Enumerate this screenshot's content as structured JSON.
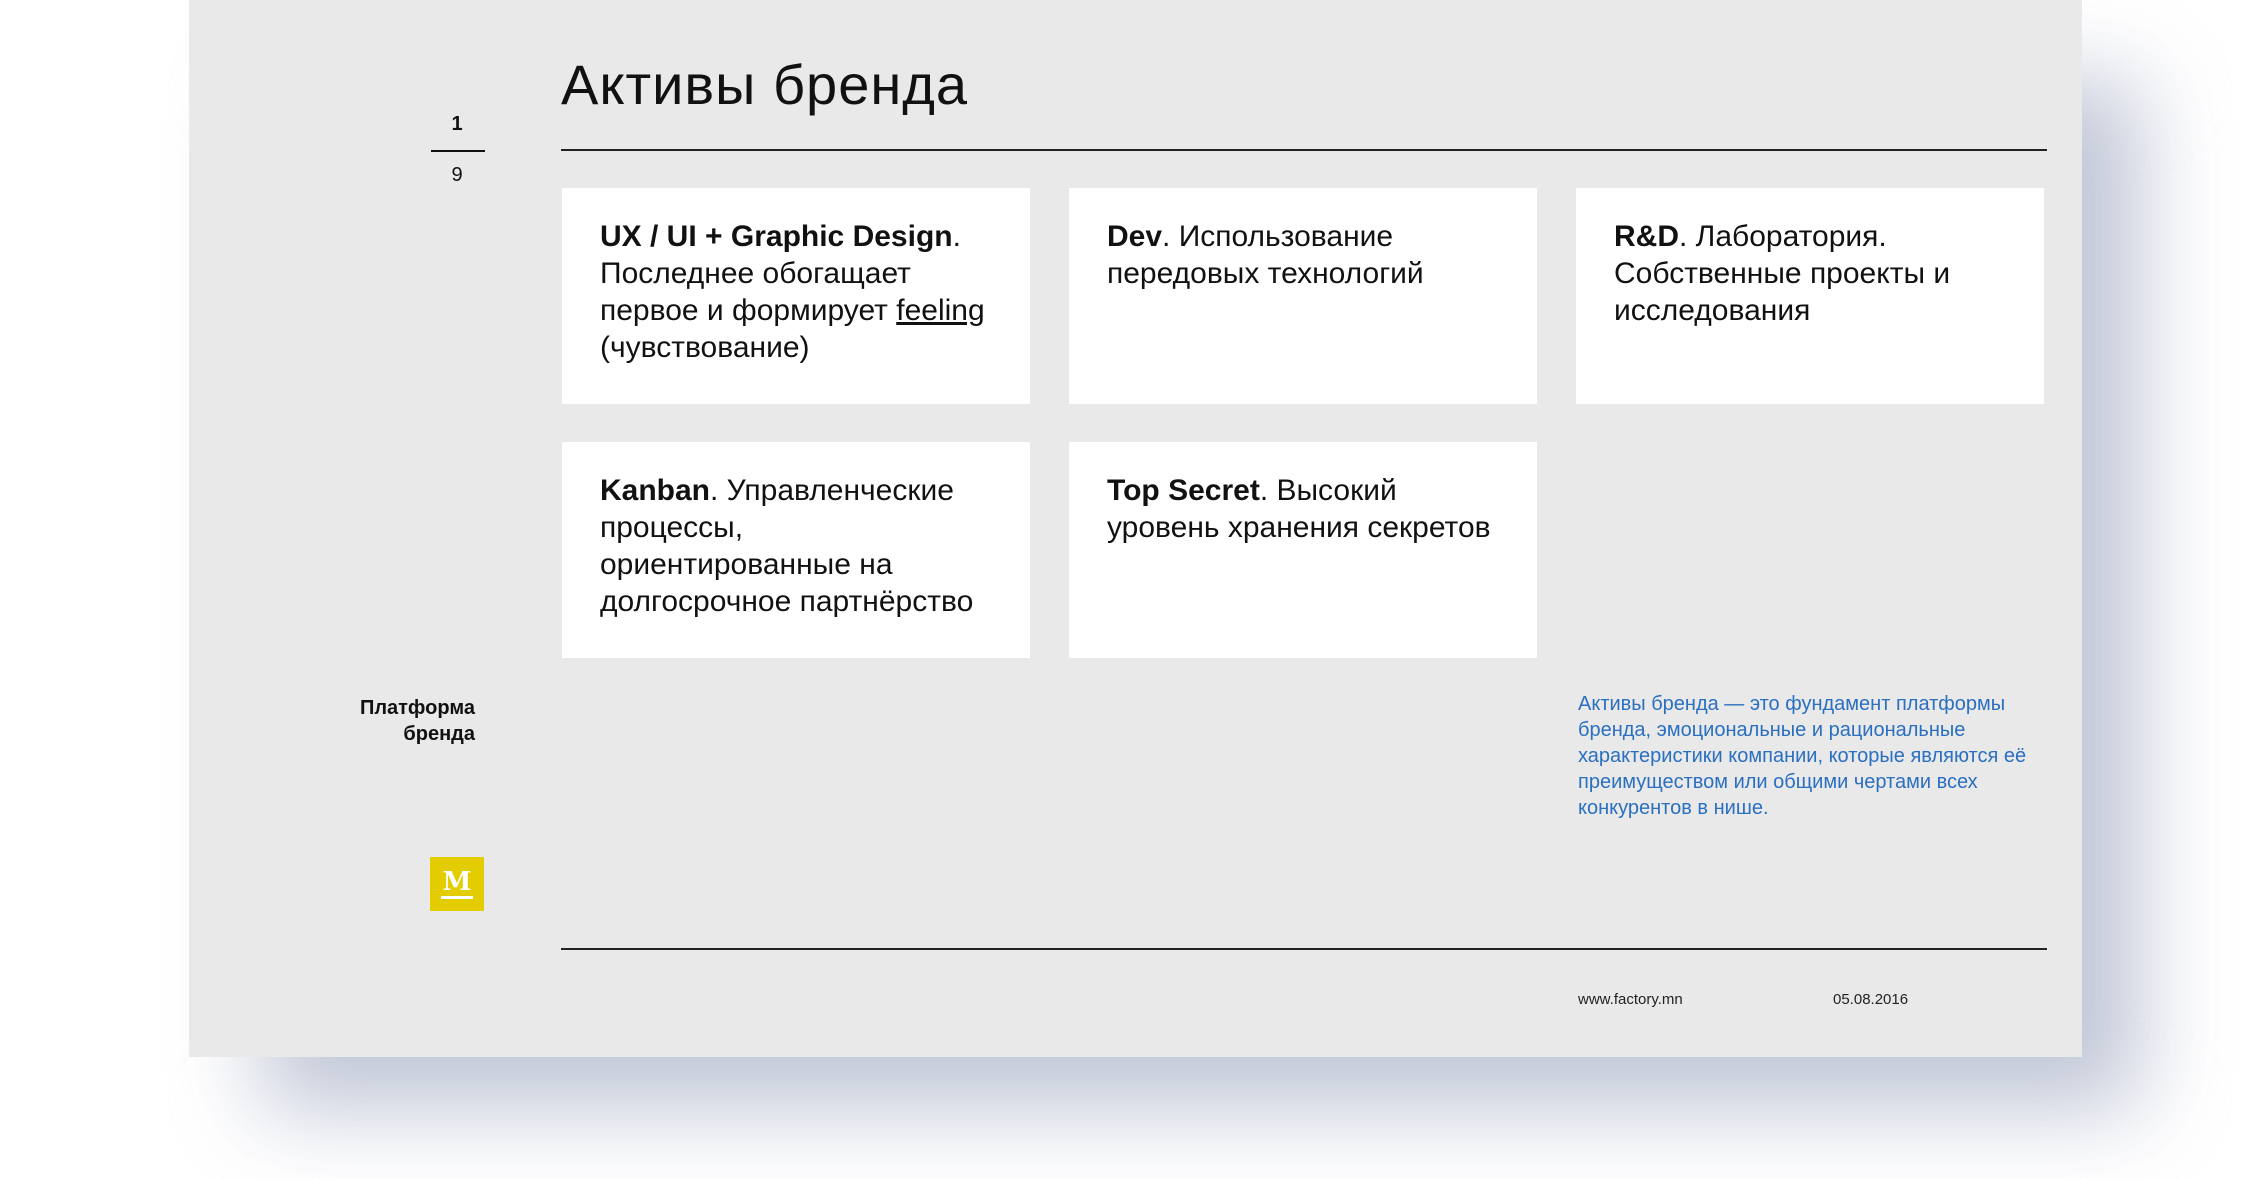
{
  "page": {
    "current": "1",
    "total": "9"
  },
  "title": "Активы бренда",
  "cards": [
    {
      "bold": "UX / UI + Graphic Design",
      "text_before_link": ". Последнее обогащает первое и формирует ",
      "link": "feeling",
      "text_after_link": " (чувствование)"
    },
    {
      "bold": "Dev",
      "text": ". Использование передовых технологий"
    },
    {
      "bold": "R&D",
      "text": ". Лаборатория. Собственные проекты и исследования"
    },
    {
      "bold": "Kanban",
      "text": ". Управленческие процессы, ориентированные на долгосрочное партнёрство"
    },
    {
      "bold": "Top Secret",
      "text": ". Высокий уровень хранения секретов"
    }
  ],
  "section_label_line1": "Платформа",
  "section_label_line2": "бренда",
  "logo_letter": "M",
  "note": "Активы бренда — это фундамент платформы бренда, эмоциональные и рациональные характеристики компании, которые являются её преимуществом или общими чертами всех конкурентов в нише.",
  "footer": {
    "url": "www.factory.mn",
    "date": "05.08.2016"
  },
  "colors": {
    "slide_background": "#e9e9e9",
    "logo_yellow": "#e3cd00",
    "note_blue": "#2a6fc0"
  }
}
